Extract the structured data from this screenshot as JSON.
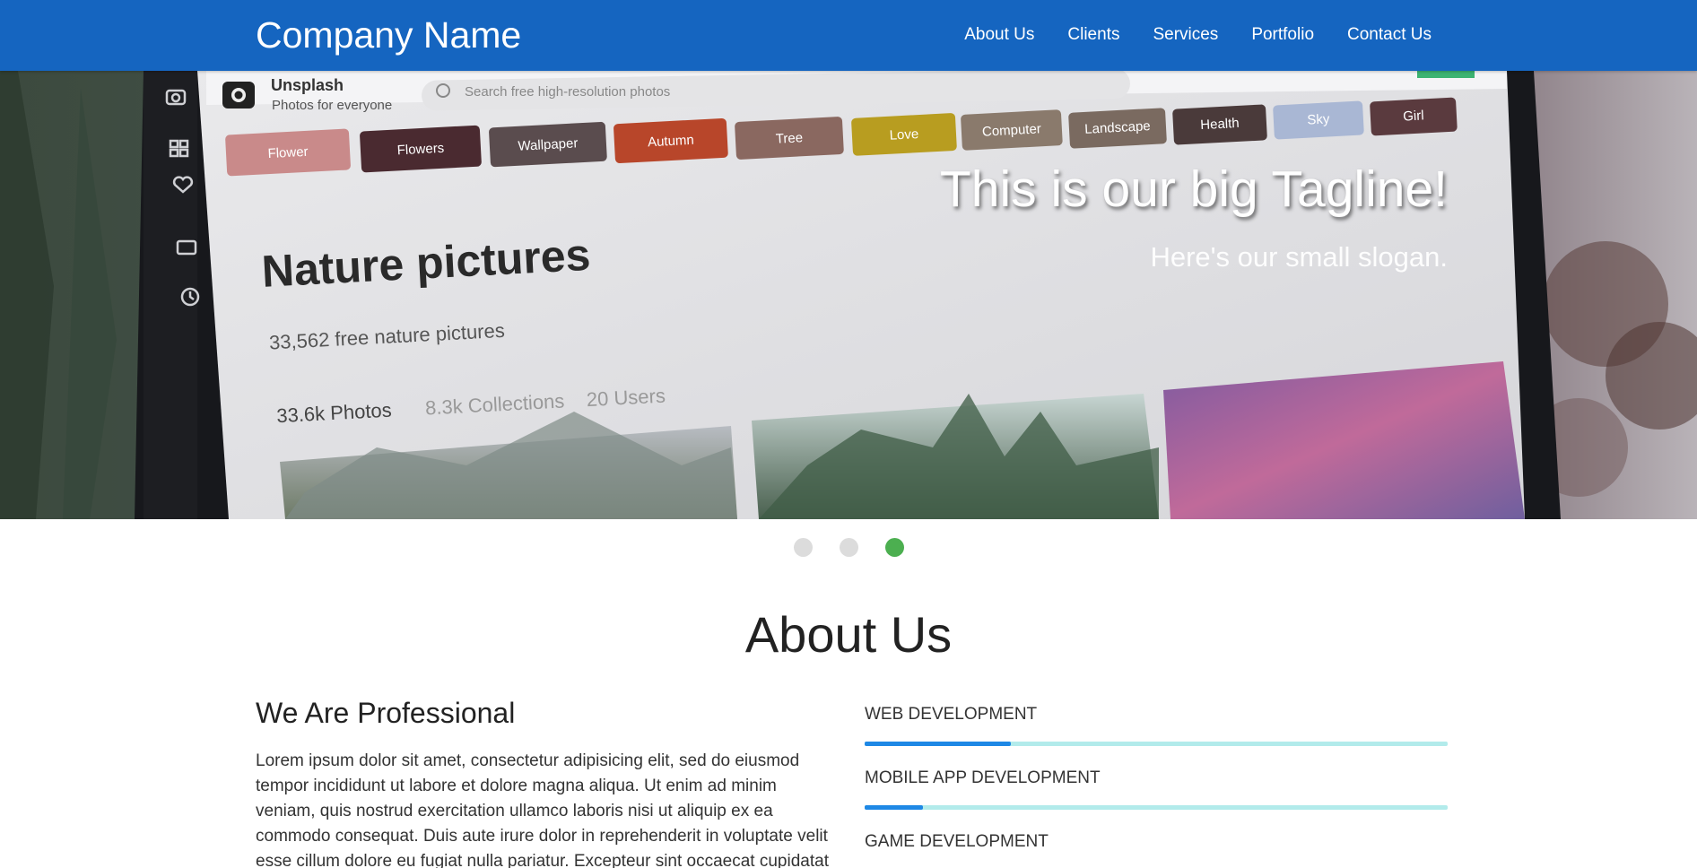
{
  "navbar": {
    "brand": "Company Name",
    "links": [
      "About Us",
      "Clients",
      "Services",
      "Portfolio",
      "Contact Us"
    ]
  },
  "hero": {
    "tagline": "This is our big Tagline!",
    "slogan": "Here's our small slogan.",
    "screen": {
      "site_name": "Unsplash",
      "site_sub": "Photos for everyone",
      "search_placeholder": "Search free high-resolution photos",
      "tags": [
        "Flower",
        "Flowers",
        "Wallpaper",
        "Autumn",
        "Tree",
        "Love",
        "Computer",
        "Landscape",
        "Health",
        "Sky",
        "Girl"
      ],
      "heading": "Nature pictures",
      "count": "33,562 free nature pictures",
      "stats": [
        "33.6k Photos",
        "8.3k Collections",
        "20 Users"
      ]
    }
  },
  "carousel": {
    "slides": 3,
    "active": 3
  },
  "about": {
    "title": "About Us",
    "subtitle": "We Are Professional",
    "body": "Lorem ipsum dolor sit amet, consectetur adipisicing elit, sed do eiusmod tempor incididunt ut labore et dolore magna aliqua. Ut enim ad minim veniam, quis nostrud exercitation ullamco laboris nisi ut aliquip ex ea commodo consequat. Duis aute irure dolor in reprehenderit in voluptate velit esse cillum dolore eu fugiat nulla pariatur. Excepteur sint occaecat cupidatat non proident,",
    "skills": [
      {
        "label": "WEB DEVELOPMENT",
        "level": 0.25
      },
      {
        "label": "MOBILE APP DEVELOPMENT",
        "level": 0.1
      },
      {
        "label": "GAME DEVELOPMENT"
      }
    ]
  },
  "colors": {
    "navbar": "#1565c0",
    "accent": "#1e88e5",
    "active_dot": "#4caf50",
    "bar_track": "#b2ebeb"
  }
}
